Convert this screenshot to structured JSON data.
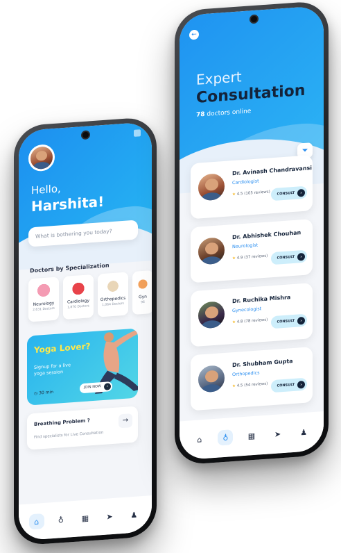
{
  "phone_left": {
    "greeting": "Hello,",
    "user_name": "Harshita!",
    "search_placeholder": "What is bothering you today?",
    "specialization_title": "Doctors by Specialization",
    "specializations": [
      {
        "label": "Neurology",
        "count": "2,631 Doctors",
        "icon": "brain-icon"
      },
      {
        "label": "Cardiology",
        "count": "1,870 Doctors",
        "icon": "heart-icon"
      },
      {
        "label": "Orthopedics",
        "count": "1,064 Doctors",
        "icon": "bone-icon"
      },
      {
        "label": "Gyn",
        "count": "96",
        "icon": "gynecology-icon"
      }
    ],
    "promo": {
      "title": "Yoga Lover?",
      "subtitle": "Signup for a live yoga session",
      "duration": "30 min",
      "join_label": "JOIN NOW"
    },
    "breathing": {
      "title": "Breathing Problem ?",
      "subtitle": "Find specialists for Live Consultation"
    },
    "tabs": [
      "home-icon",
      "stethoscope-icon",
      "calendar-icon",
      "send-icon",
      "user-icon"
    ]
  },
  "phone_right": {
    "heading_line1": "Expert",
    "heading_line2": "Consultation",
    "online_count": "78",
    "online_label": "doctors online",
    "doctors": [
      {
        "name": "Dr. Avinash Chandravansi",
        "specialty": "Cardiologist",
        "rating": "4.5",
        "reviews": "(105 reviews)"
      },
      {
        "name": "Dr. Abhishek Chouhan",
        "specialty": "Neurologist",
        "rating": "4.9",
        "reviews": "(37 reviews)"
      },
      {
        "name": "Dr. Ruchika Mishra",
        "specialty": "Gynecologist",
        "rating": "4.8",
        "reviews": "(78 reviews)"
      },
      {
        "name": "Dr. Shubham Gupta",
        "specialty": "Orthopedics",
        "rating": "4.5",
        "reviews": "(54 reviews)"
      }
    ],
    "consult_label": "CONSULT",
    "tabs": [
      "home-icon",
      "stethoscope-icon",
      "calendar-icon",
      "send-icon",
      "user-icon"
    ]
  },
  "colors": {
    "primary_blue": "#1f93f1",
    "dark_navy": "#14233a",
    "accent_yellow": "#ffe94a"
  }
}
